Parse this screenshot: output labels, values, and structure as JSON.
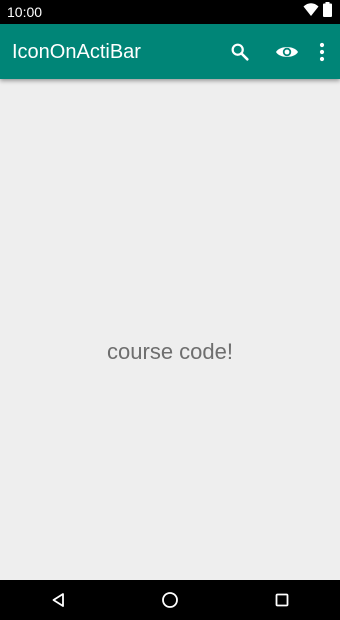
{
  "status_bar": {
    "time": "10:00",
    "icons": [
      "wifi-icon",
      "battery-icon"
    ]
  },
  "app_bar": {
    "title": "IconOnActiBar",
    "background_color": "#008577",
    "actions": [
      "search-icon",
      "eye-icon",
      "overflow-menu-icon"
    ]
  },
  "main": {
    "message": "course code!",
    "background_color": "#eeeeee"
  },
  "nav_bar": {
    "buttons": [
      "back-icon",
      "home-icon",
      "recents-icon"
    ]
  }
}
